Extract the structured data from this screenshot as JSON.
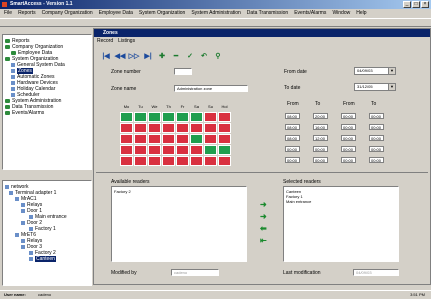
{
  "app": {
    "title": "SmartAccess - Version 1.1"
  },
  "menubar": [
    "File",
    "Reports",
    "Company Organization",
    "Employee Data",
    "System Organization",
    "System Administration",
    "Data Transmission",
    "Events/Alarms",
    "Window",
    "Help"
  ],
  "left_tree": {
    "items": [
      {
        "label": "Reports"
      },
      {
        "label": "Company Organization"
      },
      {
        "label": "Employee Data"
      },
      {
        "label": "System Organization"
      },
      {
        "label": "General System Data"
      },
      {
        "label": "Zones"
      },
      {
        "label": "Automatic Zones"
      },
      {
        "label": "Hardware Devices"
      },
      {
        "label": "Holiday Calendar"
      },
      {
        "label": "Scheduler"
      },
      {
        "label": "System Administration"
      },
      {
        "label": "Data Transmission"
      },
      {
        "label": "Events/Alarms"
      }
    ]
  },
  "network_tree": {
    "items": [
      {
        "label": "network"
      },
      {
        "label": "Terminal adapter 1"
      },
      {
        "label": "MrAC1"
      },
      {
        "label": "Relays"
      },
      {
        "label": "Door 1"
      },
      {
        "label": "Main entrance"
      },
      {
        "label": "Door 2"
      },
      {
        "label": "Factory 1"
      },
      {
        "label": "MrET6"
      },
      {
        "label": "Relays"
      },
      {
        "label": "Door 3"
      },
      {
        "label": "Factory 2"
      },
      {
        "label": "Canteen"
      }
    ]
  },
  "zones": {
    "title": "Zones",
    "menu": [
      "Record",
      "Listings"
    ],
    "zone_number_label": "Zone number",
    "zone_number_value": "",
    "zone_name_label": "Zone name",
    "zone_name_value": "Administration zone",
    "from_date_label": "From date",
    "from_date_value": "04/09/03",
    "to_date_label": "To date",
    "to_date_value": "31/12/05",
    "days": [
      "Mo",
      "Tu",
      "We",
      "Th",
      "Fr",
      "Sa",
      "Su",
      "Hol"
    ],
    "from_label": "From",
    "to_label": "To",
    "time_rows": [
      [
        "08:00",
        "20:00",
        "00:00",
        "00:00"
      ],
      [
        "08:00",
        "16:00",
        "00:00",
        "00:00"
      ],
      [
        "08:00",
        "12:00",
        "00:00",
        "00:00"
      ],
      [
        "00:00",
        "00:00",
        "00:00",
        "00:00"
      ],
      [
        "00:00",
        "00:00",
        "00:00",
        "00:00"
      ]
    ],
    "available_readers_label": "Available readers",
    "available_readers": [
      "Factory 2"
    ],
    "selected_readers_label": "Selected readers",
    "selected_readers": [
      "Canteen",
      "Factory 1",
      "Main entrance"
    ],
    "modified_by_label": "Modified by",
    "modified_by_value": "cadeno",
    "last_modification_label": "Last modification",
    "last_modification_value": "04/09/03"
  },
  "statusbar": {
    "user_label": "User name:",
    "user_value": "cadeno",
    "time": "3:51 PM"
  }
}
